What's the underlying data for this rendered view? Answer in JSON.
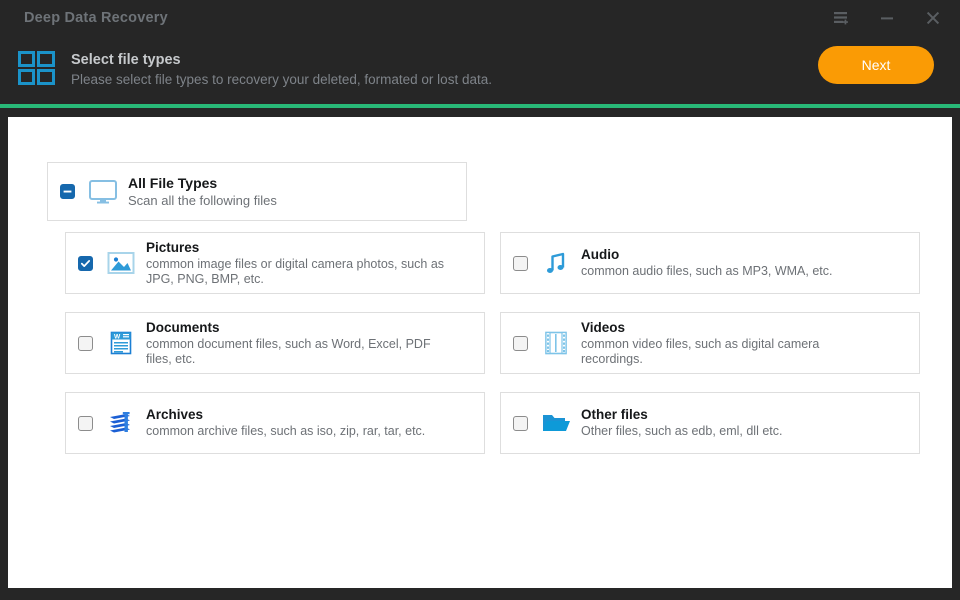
{
  "window": {
    "app_title": "Deep Data Recovery",
    "controls": [
      {
        "name": "menu-icon",
        "label": "Menu"
      },
      {
        "name": "minimize-icon",
        "label": "Minimize"
      },
      {
        "name": "close-icon",
        "label": "Close"
      }
    ]
  },
  "header": {
    "icon": "grid-four-squares-icon",
    "title": "Select file types",
    "subtitle": "Please select file types to recovery your deleted, formated or lost data.",
    "next_label": "Next"
  },
  "colors": {
    "window_bg": "#262626",
    "panel_bg": "#ffffff",
    "accent_green": "#28b877",
    "accent_orange": "#fa9b05",
    "accent_blue": "#1668ad",
    "icon_blue": "#1b7fd4",
    "light_blue": "#7ec4e8",
    "title_text": "#6e7378"
  },
  "all_file_types": {
    "title": "All File Types",
    "description": "Scan all the following files",
    "checkbox_state": "indeterminate",
    "icon": "monitor-icon"
  },
  "file_types": [
    {
      "id": "pictures",
      "title": "Pictures",
      "description": "common image files or digital camera photos, such as JPG, PNG, BMP, etc.",
      "checkbox_state": "checked",
      "icon": "image-icon"
    },
    {
      "id": "audio",
      "title": "Audio",
      "description": "common audio files, such as MP3, WMA, etc.",
      "checkbox_state": "unchecked",
      "icon": "music-note-icon"
    },
    {
      "id": "documents",
      "title": "Documents",
      "description": "common document files, such as Word, Excel, PDF files, etc.",
      "checkbox_state": "unchecked",
      "icon": "document-icon"
    },
    {
      "id": "videos",
      "title": "Videos",
      "description": "common video files, such as digital camera recordings.",
      "checkbox_state": "unchecked",
      "icon": "film-strip-icon"
    },
    {
      "id": "archives",
      "title": "Archives",
      "description": "common archive files, such as iso, zip, rar, tar, etc.",
      "checkbox_state": "unchecked",
      "icon": "archive-stack-icon"
    },
    {
      "id": "other",
      "title": "Other files",
      "description": "Other files, such as edb, eml, dll etc.",
      "checkbox_state": "unchecked",
      "icon": "folder-open-icon"
    }
  ]
}
